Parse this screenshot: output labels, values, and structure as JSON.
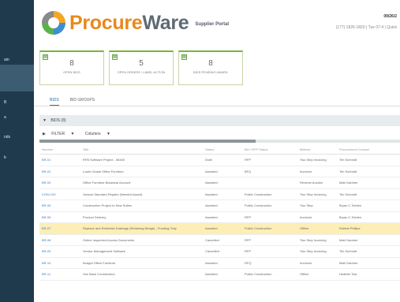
{
  "sidebar": {
    "items": [
      "ain",
      "",
      "B",
      "a",
      "nds",
      "b"
    ]
  },
  "header": {
    "brand_procure": "Procure",
    "brand_ware": "Ware",
    "portal": "Supplier Portal",
    "date": "09/26/2",
    "user": "(177) 1826-1820 | Tue 07:4 | Quick"
  },
  "cards": [
    {
      "count": "8",
      "label": "OPEN BIDS"
    },
    {
      "count": "5",
      "label": "OPEN ORDERS / LABEL ACTION"
    },
    {
      "count": "8",
      "label": "BIDS PENDING AWARD"
    }
  ],
  "tabs": [
    "BIDS",
    "BID GROUPS"
  ],
  "filter_bar": {
    "chevron": "▼",
    "label": "BIDS",
    "count": "(8)"
  },
  "filter_row": {
    "arrow": "▶",
    "filter_label": "FILTER",
    "filter_chevron": "▼",
    "columns_label": "Columns",
    "columns_chevron": "▼"
  },
  "scroll": {
    "progress": 0.6
  },
  "table": {
    "columns": [
      "Number",
      "Title",
      "Status",
      "Bid / RFP Status",
      "Method",
      "Procurement Contact"
    ],
    "rows": [
      [
        "BR-01",
        "RFB Software Project - 58400",
        "Draft",
        "RFP",
        "Two Step Invoicing",
        "Tim Schmidt"
      ],
      [
        "BR-02",
        "Lower Grade Office Furniture",
        "Awarded",
        "BFQ",
        "Invoiced",
        "Tim Schmidt"
      ],
      [
        "BR-03",
        "Office Furniture Botanical Account",
        "Awarded",
        "",
        "Reverse Auction",
        "Matt Gardner"
      ],
      [
        "CON-C00",
        "Various Standard Repairs (Needed Award)",
        "Awarded",
        "Public Construction",
        "Two Step Invoicing",
        "Tim Schmidt"
      ],
      [
        "BR-05",
        "Construction Project to New Suites",
        "Awarded",
        "Public Construction",
        "Two Step",
        "Bryan C Selden"
      ],
      [
        "BR-06",
        "Product Delivery",
        "Awarded",
        "RFP",
        "Invoiced",
        "Bryan C Selden"
      ],
      [
        "BR-07",
        "Replace and Refurbish Drainage (Retaining Bridge) - Funding Only",
        "Awarded",
        "Public Construction",
        "Offline",
        "Robbie Phillips"
      ],
      [
        "BR-08",
        "Online Inspected Access Documents",
        "Cancelled",
        "RFP",
        "Two Step Invoicing",
        "Matt Gardner"
      ],
      [
        "BR-09",
        "Vendor Management Software",
        "Cancelled",
        "RFP",
        "Two Step Invoicing",
        "Tim Schmidt"
      ],
      [
        "BR-10",
        "Budget Office Furniture",
        "Awarded",
        "RFQ",
        "Invoiced",
        "Matt Gardner"
      ],
      [
        "BR-11",
        "Vee Base Construction",
        "Awarded",
        "Public Construction",
        "Offline",
        "Heather Tsai"
      ]
    ],
    "highlighted_row_index": 6
  }
}
